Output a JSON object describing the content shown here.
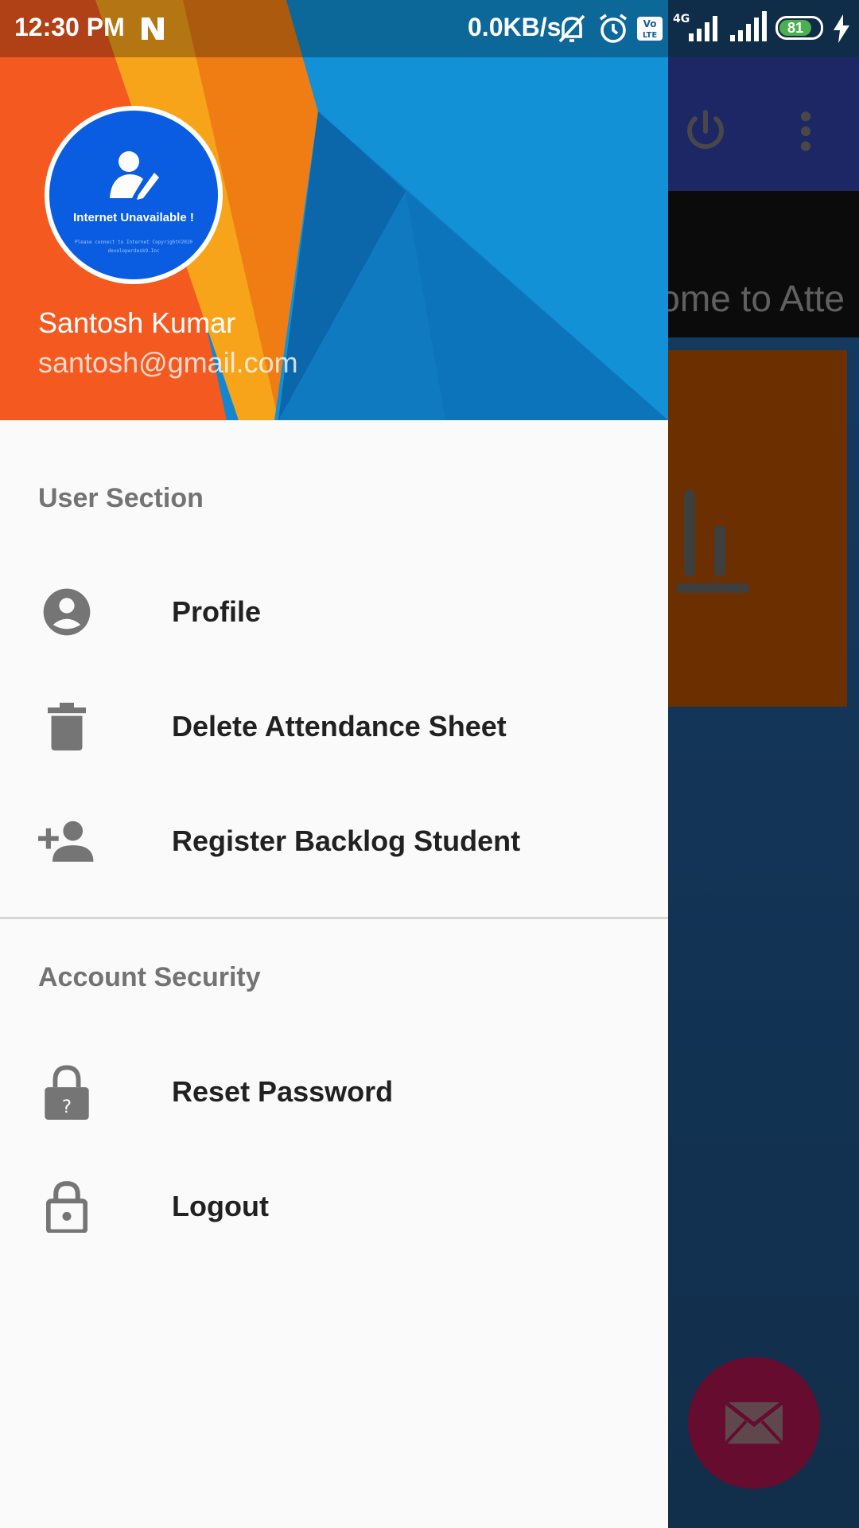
{
  "status_bar": {
    "time": "12:30 PM",
    "net_speed": "0.0KB/s",
    "network_type": "4G",
    "volte": "Vo LTE",
    "battery_level": "81",
    "icons": [
      "n-notification-icon",
      "mute-icon",
      "alarm-icon",
      "volte-icon",
      "signal-icon",
      "signal-icon",
      "battery-icon",
      "charging-icon"
    ]
  },
  "background_app": {
    "welcome_text": "ome to Atte",
    "toolbar_icons": [
      "power-icon",
      "more-vert-icon"
    ],
    "card_icon": "bar-chart-icon",
    "fab_icon": "mail-icon",
    "colors": {
      "toolbar": "#3a4cc4",
      "card": "#cf5a00",
      "fab": "#c2185b"
    }
  },
  "drawer": {
    "header": {
      "avatar_text": "Internet Unavailable !",
      "avatar_subtext": "Please connect to Internet Copyright©2020 developerdesk9.Inc",
      "user_name": "Santosh Kumar",
      "user_email": "santosh@gmail.com"
    },
    "sections": [
      {
        "title": "User Section",
        "items": [
          {
            "label": "Profile",
            "icon": "account-circle-icon"
          },
          {
            "label": "Delete Attendance Sheet",
            "icon": "delete-icon"
          },
          {
            "label": "Register Backlog Student",
            "icon": "person-add-icon"
          }
        ]
      },
      {
        "title": "Account Security",
        "items": [
          {
            "label": "Reset Password",
            "icon": "lock-question-icon"
          },
          {
            "label": "Logout",
            "icon": "lock-icon"
          }
        ]
      }
    ]
  }
}
